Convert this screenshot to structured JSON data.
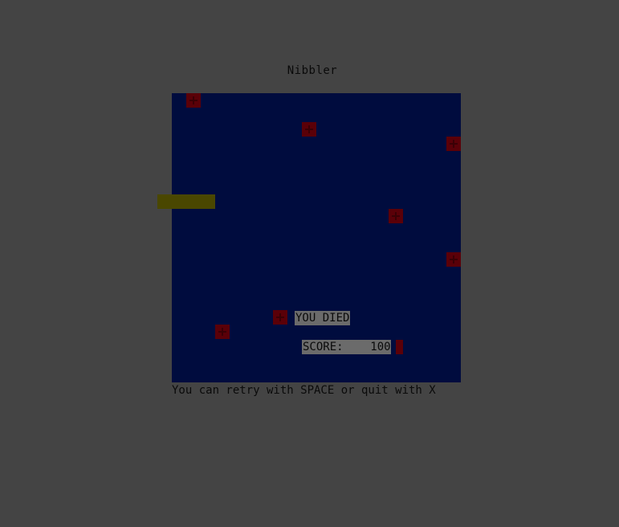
{
  "game": {
    "title": "Nibbler",
    "died_text": "YOU DIED",
    "score_label": "SCORE:",
    "score_value": "100",
    "hint_text": "You can retry with SPACE or quit with X"
  },
  "colors": {
    "background": "#444444",
    "board": "#000c3e",
    "food": "#5a0008",
    "snake": "#4a4700",
    "message_bg": "#6b6b6b"
  }
}
